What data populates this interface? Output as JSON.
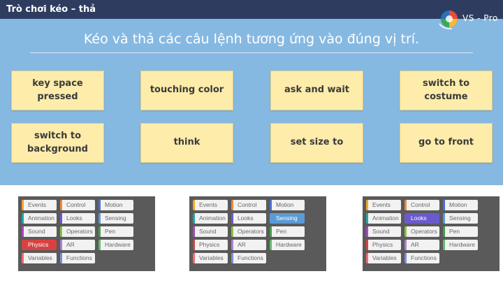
{
  "header": {
    "title": "Trò chơi kéo – thả"
  },
  "logo": {
    "text": "VS - Pro"
  },
  "instruction": "Kéo và thả các câu lệnh tương ứng vào đúng vị trí.",
  "cards": [
    {
      "label": "key space pressed"
    },
    {
      "label": "touching color"
    },
    {
      "label": "ask and wait"
    },
    {
      "label": "switch to costume"
    },
    {
      "label": "switch to background"
    },
    {
      "label": "think"
    },
    {
      "label": "set size to"
    },
    {
      "label": "go to front"
    }
  ],
  "categories": [
    {
      "label": "Events",
      "color": "#f5a623"
    },
    {
      "label": "Animation",
      "color": "#26a69a"
    },
    {
      "label": "Sound",
      "color": "#ab47bc"
    },
    {
      "label": "Physics",
      "color": "#d94141"
    },
    {
      "label": "Variables",
      "color": "#ef6c6c"
    },
    {
      "label": "Control",
      "color": "#ef8a3a"
    },
    {
      "label": "Looks",
      "color": "#6a5acd"
    },
    {
      "label": "Operators",
      "color": "#8bc34a"
    },
    {
      "label": "AR",
      "color": "#b07fd6"
    },
    {
      "label": "Functions",
      "color": "#7e8ce0"
    },
    {
      "label": "Motion",
      "color": "#4a6fd8"
    },
    {
      "label": "Sensing",
      "color": "#5b9bd5"
    },
    {
      "label": "Pen",
      "color": "#43a047"
    },
    {
      "label": "Hardware",
      "color": "#66bb6a"
    }
  ],
  "palettes": [
    {
      "selected": "Physics"
    },
    {
      "selected": "Sensing"
    },
    {
      "selected": "Looks"
    }
  ],
  "colors": {
    "header_bg": "#2e3d5f",
    "panel_bg": "#86b9e2",
    "card_bg": "#fdecaa",
    "palette_bg": "#5a5a5a"
  }
}
